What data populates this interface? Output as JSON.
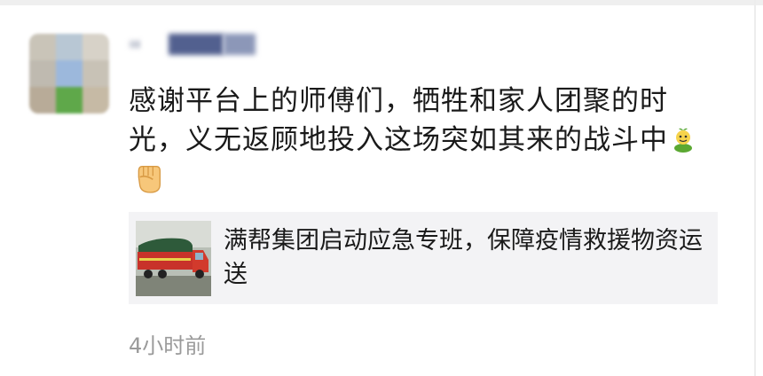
{
  "post": {
    "text": "感谢平台上的师傅们，牺牲和家人团聚的时光，义无返顾地投入这场突如其来的战斗中",
    "emojis": [
      "sprout-figure-emoji",
      "fist-emoji"
    ]
  },
  "link_card": {
    "title": "满帮集团启动应急专班，保障疫情救援物资运送",
    "thumbnail_icon": "truck-photo"
  },
  "meta": {
    "timestamp": "4小时前"
  },
  "colors": {
    "card_bg": "#f3f3f5",
    "text": "#1a1a1a",
    "muted": "#9a9a9a",
    "username_blur": "#4a5a8a"
  }
}
